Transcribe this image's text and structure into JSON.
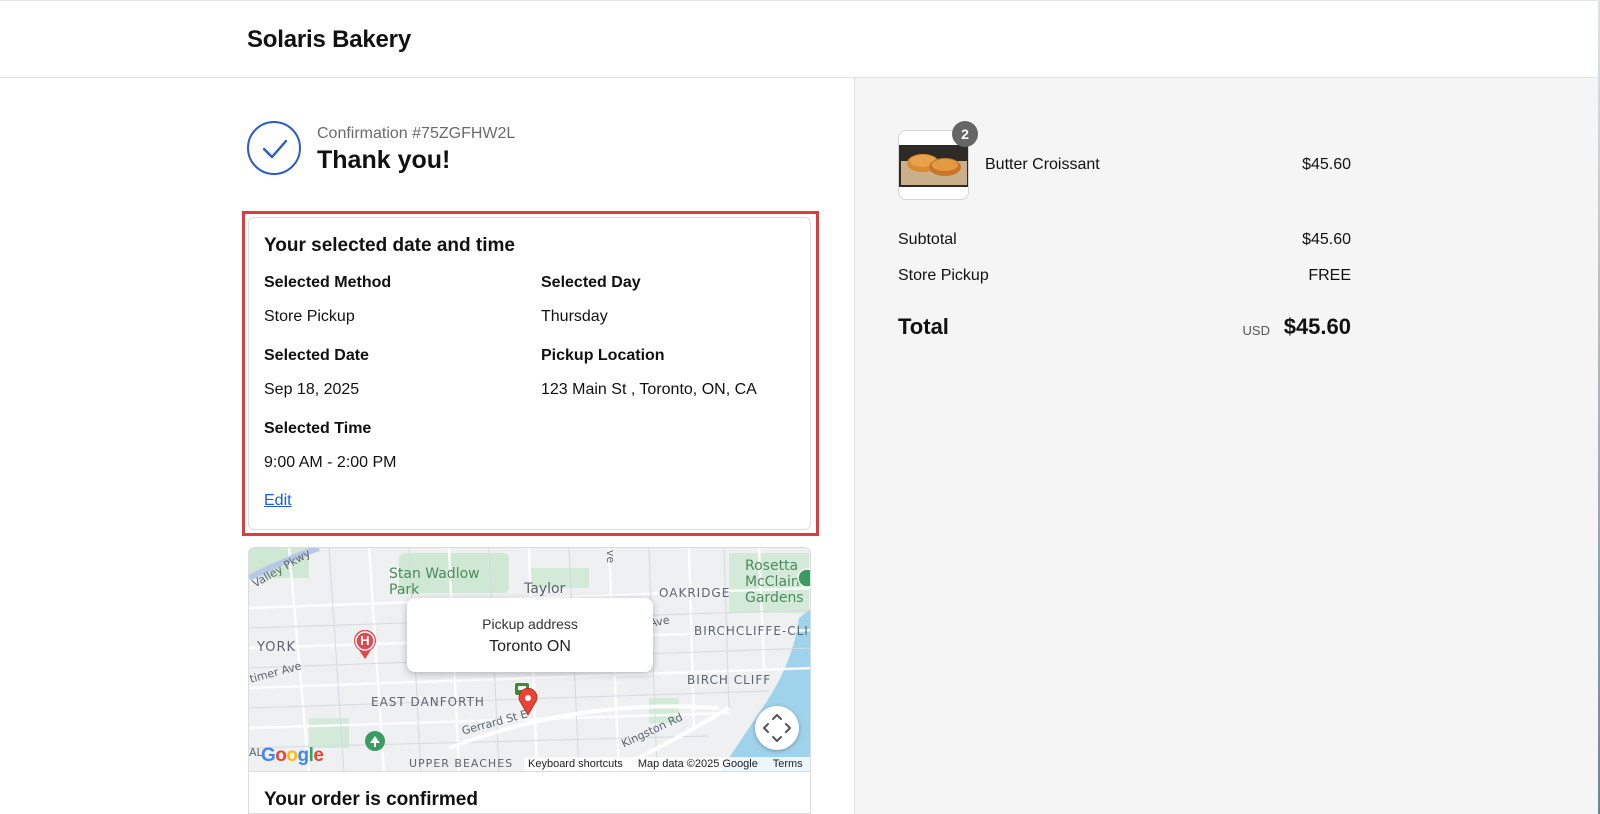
{
  "header": {
    "brand": "Solaris Bakery"
  },
  "confirmation": {
    "number_text": "Confirmation #75ZGFHW2L",
    "heading": "Thank you!"
  },
  "selection": {
    "title": "Your selected date and time",
    "method_label": "Selected Method",
    "method_value": "Store Pickup",
    "day_label": "Selected Day",
    "day_value": "Thursday",
    "date_label": "Selected Date",
    "date_value": "Sep 18, 2025",
    "location_label": "Pickup Location",
    "location_value": "123 Main St , Toronto, ON, CA",
    "time_label": "Selected Time",
    "time_value": "9:00 AM - 2:00 PM",
    "edit_label": "Edit"
  },
  "map": {
    "card_title": "Pickup address",
    "card_city": "Toronto ON",
    "places": {
      "stan_wadlow": "Stan Wadlow\nPark",
      "taylor": "Taylor",
      "oakridge": "OAKRIDGE",
      "rosetta": "Rosetta\nMcClain\nGardens",
      "birchcliffe_cliffside": "BIRCHCLIFFE-CLI",
      "birch_cliff": "BIRCH CLIFF",
      "york": "YORK",
      "east_danforth": "EAST DANFORTH",
      "upper_beaches": "UPPER BEACHES",
      "gerrard": "Gerrard St E",
      "kingston": "Kingston Rd",
      "timer_ave": "timer Ave",
      "valley_pkwy": "Valley Pkwy",
      "h_ave": "h Ave",
      "ave_top": "ve",
      "al": "AL"
    },
    "hospital_glyph": "H",
    "google_logo": "Google",
    "footer": {
      "shortcuts": "Keyboard shortcuts",
      "data": "Map data ©2025 Google",
      "terms": "Terms"
    }
  },
  "next_section": {
    "title": "Your order is confirmed"
  },
  "order": {
    "quantity": "2",
    "item_name": "Butter Croissant",
    "item_price": "$45.60",
    "subtotal_label": "Subtotal",
    "subtotal_value": "$45.60",
    "shipping_label": "Store Pickup",
    "shipping_value": "FREE",
    "total_label": "Total",
    "currency": "USD",
    "total_value": "$45.60"
  },
  "colors": {
    "accent": "#2b5cc7",
    "link": "#1e5bd8",
    "highlight": "#e03c3c",
    "sidebar_bg": "#f5f5f5"
  },
  "icons": [
    "checkmark-icon",
    "hospital-icon",
    "map-pin-icon",
    "transit-icon",
    "fullscreen-icon",
    "park-icon"
  ]
}
